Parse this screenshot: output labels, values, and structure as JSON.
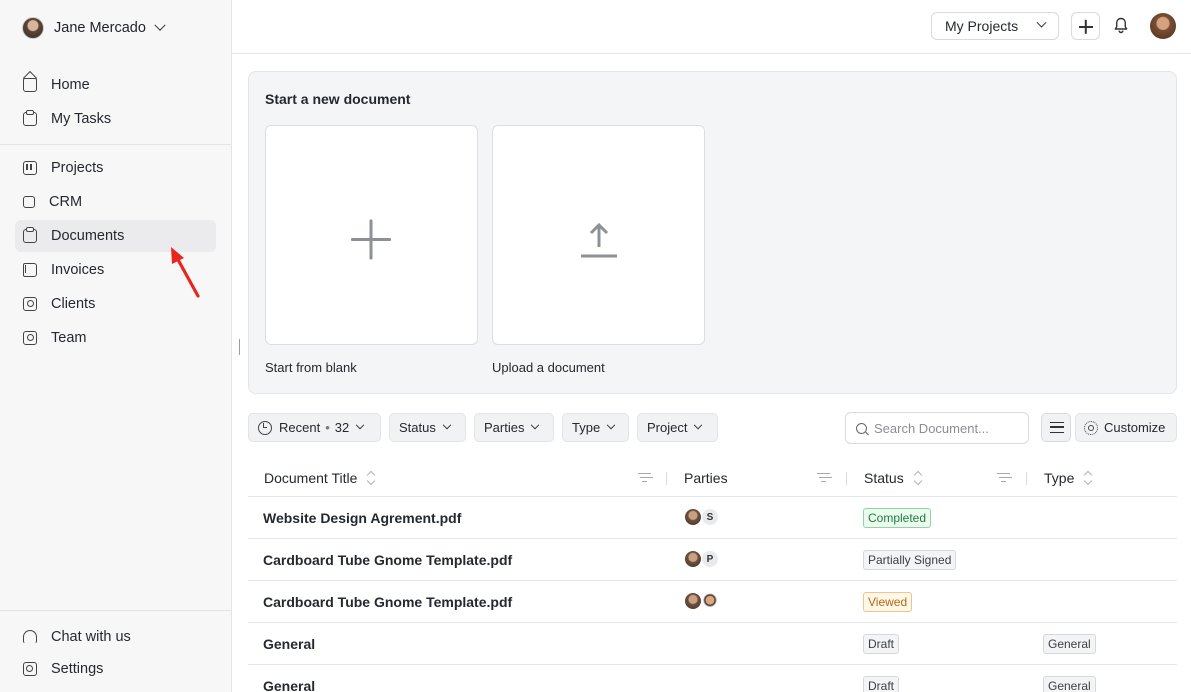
{
  "user": {
    "name": "Jane Mercado"
  },
  "nav": {
    "main": [
      {
        "label": "Home",
        "icon": "home-icon"
      },
      {
        "label": "My Tasks",
        "icon": "clipboard-icon"
      }
    ],
    "work": [
      {
        "label": "Projects",
        "icon": "board-icon"
      },
      {
        "label": "CRM",
        "icon": "crm-icon"
      },
      {
        "label": "Documents",
        "icon": "document-icon",
        "active": true
      },
      {
        "label": "Invoices",
        "icon": "bookmark-icon"
      },
      {
        "label": "Clients",
        "icon": "contact-icon"
      },
      {
        "label": "Team",
        "icon": "team-icon"
      }
    ],
    "bottom": [
      {
        "label": "Chat with us",
        "icon": "headset-icon"
      },
      {
        "label": "Settings",
        "icon": "settings-icon"
      }
    ]
  },
  "topbar": {
    "project_select": "My Projects"
  },
  "new_document": {
    "title": "Start a new document",
    "blank_label": "Start from blank",
    "upload_label": "Upload a document"
  },
  "filters": {
    "recent": "Recent",
    "recent_count": "32",
    "status": "Status",
    "parties": "Parties",
    "type": "Type",
    "project": "Project",
    "search_placeholder": "Search Document...",
    "customize": "Customize"
  },
  "table": {
    "columns": [
      "Document Title",
      "Parties",
      "Status",
      "Type"
    ],
    "rows": [
      {
        "title": "Website Design Agrement.pdf",
        "party_kind": "letter",
        "party_letter": "S",
        "status": "Completed",
        "status_kind": "completed",
        "type": ""
      },
      {
        "title": "Cardboard Tube Gnome Template.pdf",
        "party_kind": "letter",
        "party_letter": "P",
        "status": "Partially Signed",
        "status_kind": "neutral",
        "type": ""
      },
      {
        "title": "Cardboard Tube Gnome Template.pdf",
        "party_kind": "face",
        "party_letter": "",
        "status": "Viewed",
        "status_kind": "viewed",
        "type": ""
      },
      {
        "title": "General",
        "party_kind": "none",
        "party_letter": "",
        "status": "Draft",
        "status_kind": "neutral",
        "type": "General"
      },
      {
        "title": "General",
        "party_kind": "none",
        "party_letter": "",
        "status": "Draft",
        "status_kind": "neutral",
        "type": "General"
      }
    ]
  },
  "colors": {
    "accent_red": "#e8261e",
    "completed": "#1a7f3c",
    "viewed": "#b5690f"
  }
}
